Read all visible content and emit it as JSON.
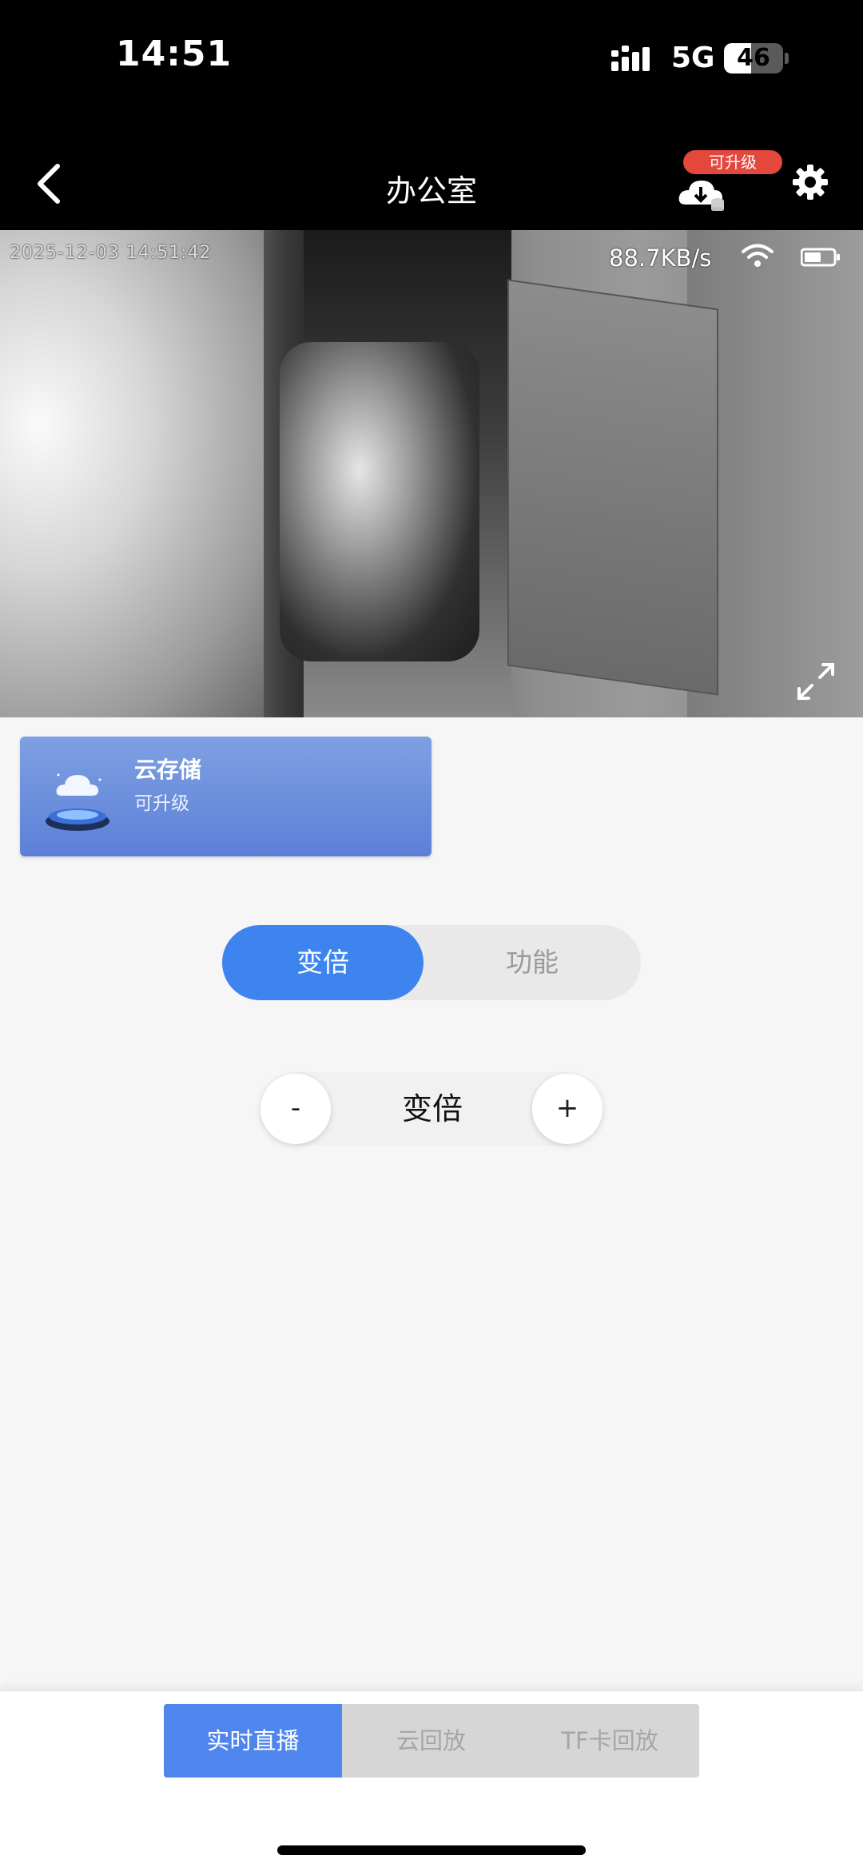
{
  "status_bar": {
    "time": "14:51",
    "network": "5G",
    "battery": "46",
    "battery_level": 0.46
  },
  "nav": {
    "title": "办公室",
    "upgrade_badge": "可升级"
  },
  "video": {
    "timestamp": "2025-12-03  14:51:42",
    "speed": "88.7KB/s"
  },
  "cloud_card": {
    "title": "云存储",
    "subtitle": "可升级"
  },
  "segment": {
    "active": "变倍",
    "inactive": "功能"
  },
  "zoom": {
    "minus": "-",
    "label": "变倍",
    "plus": "+"
  },
  "bottom_tabs": {
    "live": "实时直播",
    "cloud": "云回放",
    "tf": "TF卡回放"
  },
  "colors": {
    "accent": "#3d84ef",
    "badge": "#e4483d",
    "card": "#6f91dd"
  }
}
